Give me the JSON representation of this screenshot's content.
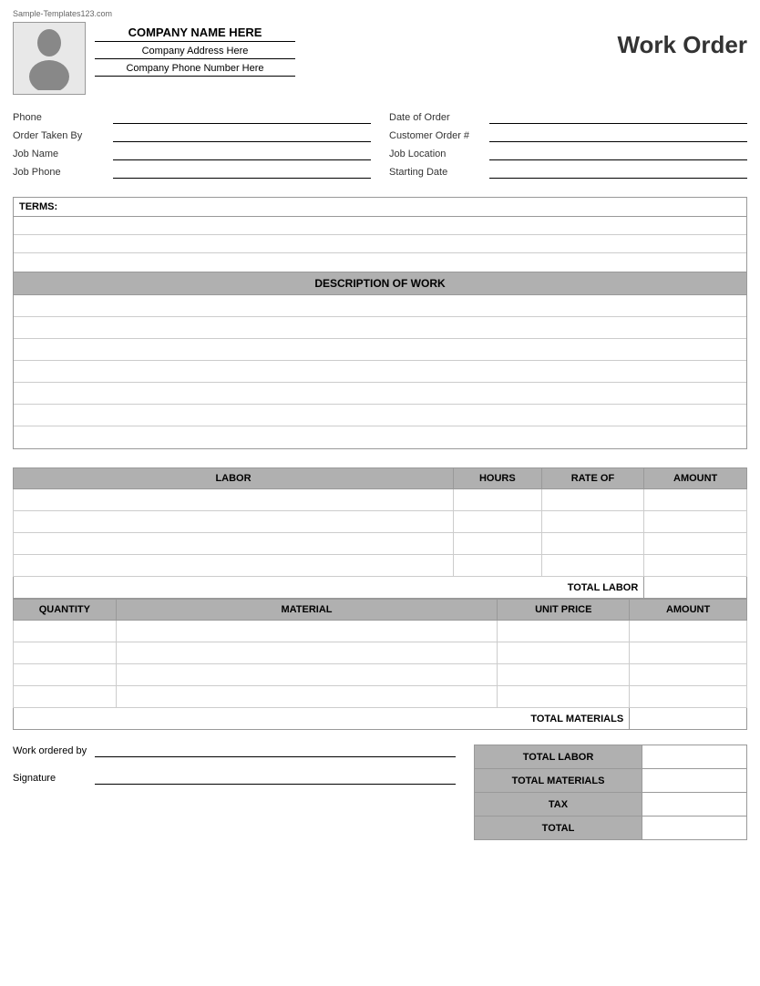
{
  "watermark": "Sample-Templates123.com",
  "header": {
    "company_name": "COMPANY NAME HERE",
    "company_address": "Company Address Here",
    "company_phone": "Company Phone Number Here",
    "title": "Work Order"
  },
  "form": {
    "left": [
      {
        "label": "Phone",
        "id": "phone"
      },
      {
        "label": "Order Taken By",
        "id": "order-taken-by"
      },
      {
        "label": "Job Name",
        "id": "job-name"
      },
      {
        "label": "Job Phone",
        "id": "job-phone"
      }
    ],
    "right": [
      {
        "label": "Date of Order",
        "id": "date-of-order"
      },
      {
        "label": "Customer Order #",
        "id": "customer-order"
      },
      {
        "label": "Job Location",
        "id": "job-location"
      },
      {
        "label": "Starting Date",
        "id": "starting-date"
      }
    ]
  },
  "terms": {
    "header": "TERMS:",
    "rows": 3
  },
  "description": {
    "header": "DESCRIPTION OF WORK",
    "rows": 7
  },
  "labor": {
    "columns": [
      "LABOR",
      "HOURS",
      "RATE OF",
      "AMOUNT"
    ],
    "rows": 4,
    "total_label": "TOTAL LABOR"
  },
  "materials": {
    "columns": [
      "QUANTITY",
      "MATERIAL",
      "UNIT PRICE",
      "AMOUNT"
    ],
    "rows": 4,
    "total_label": "TOTAL MATERIALS"
  },
  "summary": {
    "rows": [
      {
        "label": "TOTAL LABOR"
      },
      {
        "label": "TOTAL MATERIALS"
      },
      {
        "label": "TAX"
      },
      {
        "label": "TOTAL"
      }
    ]
  },
  "signature": {
    "work_ordered_by": "Work ordered by",
    "signature": "Signature"
  }
}
